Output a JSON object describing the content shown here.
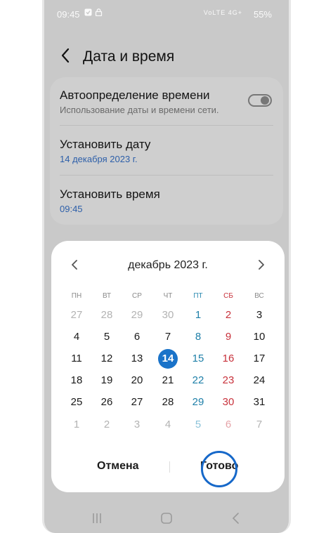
{
  "status_bar": {
    "time": "09:45",
    "network": "VoLTE 4G+",
    "battery": "55%"
  },
  "header": {
    "title": "Дата и время"
  },
  "settings": {
    "auto_time": {
      "title": "Автоопределение времени",
      "subtitle": "Использование даты и времени сети.",
      "enabled": false
    },
    "set_date": {
      "title": "Установить дату",
      "value": "14 декабря 2023 г."
    },
    "set_time": {
      "title": "Установить время",
      "value": "09:45"
    }
  },
  "calendar": {
    "month_label": "декабрь 2023 г.",
    "weekdays": [
      "ПН",
      "ВТ",
      "СР",
      "ЧТ",
      "ПТ",
      "СБ",
      "ВС"
    ],
    "weeks": [
      [
        "27",
        "28",
        "29",
        "30",
        "1",
        "2",
        "3"
      ],
      [
        "4",
        "5",
        "6",
        "7",
        "8",
        "9",
        "10"
      ],
      [
        "11",
        "12",
        "13",
        "14",
        "15",
        "16",
        "17"
      ],
      [
        "18",
        "19",
        "20",
        "21",
        "22",
        "23",
        "24"
      ],
      [
        "25",
        "26",
        "27",
        "28",
        "29",
        "30",
        "31"
      ],
      [
        "1",
        "2",
        "3",
        "4",
        "5",
        "6",
        "7"
      ]
    ],
    "selected_day": "14",
    "cancel_label": "Отмена",
    "done_label": "Готово"
  },
  "colors": {
    "accent": "#1a73c9",
    "saturday": "#1e7fa8",
    "sunday": "#c8323c",
    "highlight_ring": "#1668c9"
  },
  "icons": {
    "status": [
      "notification-icon",
      "lock-icon"
    ],
    "navigation": [
      "back-arrow-icon",
      "chevron-left-icon",
      "chevron-right-icon"
    ],
    "system_nav": [
      "recent-apps-icon",
      "home-icon",
      "system-back-icon"
    ]
  }
}
